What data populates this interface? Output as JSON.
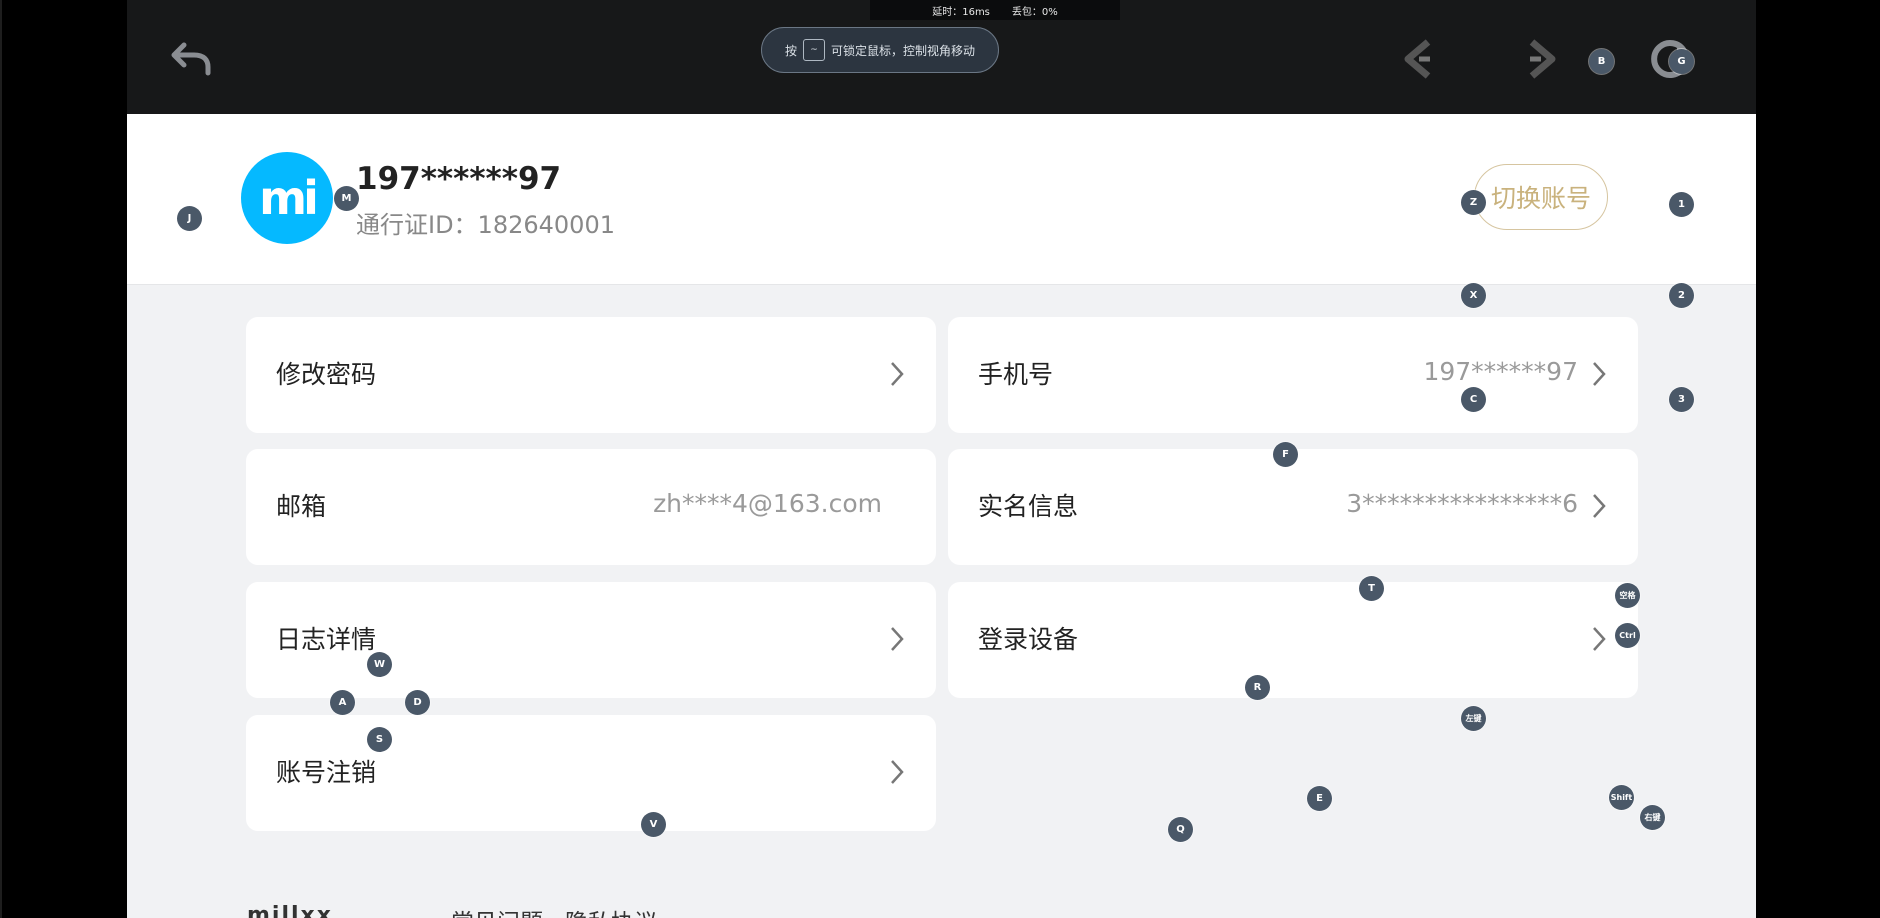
{
  "toolbar": {
    "latency": "延时：16ms",
    "packet_loss": "丢包：0%",
    "hint_prefix": "按",
    "hint_key": "~",
    "hint_text": "可锁定鼠标，控制视角移动"
  },
  "account": {
    "avatar_text": "mi",
    "masked_phone": "197******97",
    "passport_id": "通行证ID：182640001",
    "switch_account": "切换账号"
  },
  "settings": {
    "change_password": "修改密码",
    "phone_label": "手机号",
    "phone_value": "197******97",
    "email_label": "邮箱",
    "email_value": "zh****4@163.com",
    "real_name_label": "实名信息",
    "real_name_value": "3****************6",
    "log_details": "日志详情",
    "login_devices": "登录设备",
    "delete_account": "账号注销"
  },
  "footer": {
    "logo": "millxx",
    "link_1": "常见问题",
    "link_2": "隐私协议"
  },
  "overlay_keys": {
    "j": "J",
    "m": "M",
    "b": "B",
    "g": "G",
    "z": "Z",
    "k1": "1",
    "x": "X",
    "k2": "2",
    "c": "C",
    "k3": "3",
    "f": "F",
    "t": "T",
    "space": "空格",
    "ctrl": "Ctrl",
    "w": "W",
    "a": "A",
    "d": "D",
    "s": "S",
    "r": "R",
    "left": "左键",
    "e": "E",
    "shift": "Shift",
    "right": "右键",
    "q": "Q",
    "v": "V"
  },
  "colors": {
    "accent_blue": "#05b9ff",
    "switch_gold": "#c9b27d",
    "overlay_key": "#4a5868",
    "topbar": "#171819"
  }
}
